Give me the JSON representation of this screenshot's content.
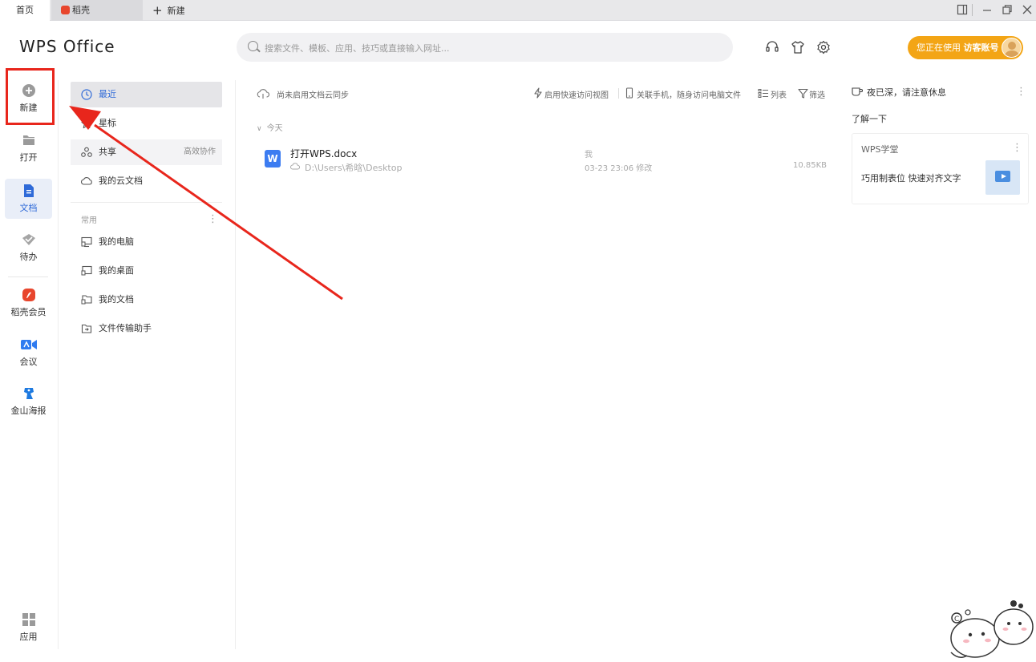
{
  "tabs": {
    "home": "首页",
    "daoke": "稻壳",
    "new_tab": "新建"
  },
  "brand": "WPS Office",
  "search": {
    "placeholder": "搜索文件、模板、应用、技巧或直接输入网址..."
  },
  "account": {
    "prefix": "您正在使用",
    "name": "访客账号"
  },
  "rail": {
    "new": "新建",
    "open": "打开",
    "docs": "文档",
    "todo": "待办",
    "daoke_member": "稻壳会员",
    "meeting": "会议",
    "poster": "金山海报",
    "apps": "应用"
  },
  "nav": {
    "recent": "最近",
    "starred": "星标",
    "shared": "共享",
    "shared_note": "高效协作",
    "cloud_docs": "我的云文档",
    "common": "常用",
    "my_computer": "我的电脑",
    "my_desktop": "我的桌面",
    "my_documents": "我的文档",
    "file_transfer": "文件传输助手"
  },
  "toolbar": {
    "cloud_sync": "尚未启用文档云同步",
    "quick_view": "启用快速访问视图",
    "link_phone": "关联手机，随身访问电脑文件",
    "list": "列表",
    "filter": "筛选"
  },
  "main": {
    "group_today": "今天",
    "files": [
      {
        "name": "打开WPS.docx",
        "path": "D:\\Users\\希晗\\Desktop",
        "owner": "我",
        "modified": "03-23 23:06 修改",
        "size": "10.85KB"
      }
    ]
  },
  "right_panel": {
    "night_notice": "夜已深，请注意休息",
    "learn_more": "了解一下",
    "card_title": "WPS学堂",
    "card_desc": "巧用制表位 快速对齐文字"
  },
  "colors": {
    "accent_blue": "#2f6ad8",
    "account_orange": "#f3a515",
    "annotation_red": "#e8261c"
  }
}
